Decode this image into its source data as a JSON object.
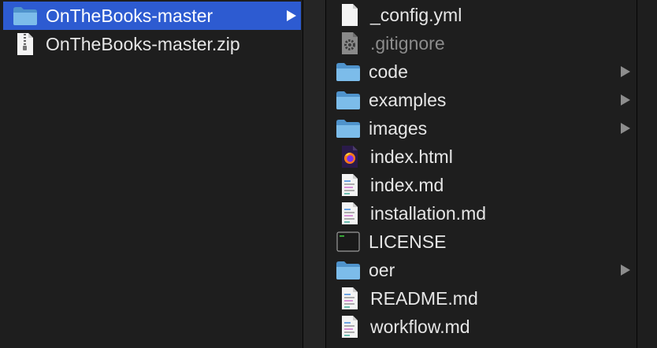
{
  "left_column": {
    "items": [
      {
        "label": "OnTheBooks-master",
        "icon": "folder-icon",
        "selected": true,
        "has_children": true
      },
      {
        "label": "OnTheBooks-master.zip",
        "icon": "zip-file-icon",
        "selected": false,
        "has_children": false
      }
    ]
  },
  "right_column": {
    "items": [
      {
        "label": "_config.yml",
        "icon": "document-icon",
        "has_children": false,
        "dim": false
      },
      {
        "label": ".gitignore",
        "icon": "gear-document-icon",
        "has_children": false,
        "dim": true
      },
      {
        "label": "code",
        "icon": "folder-icon",
        "has_children": true,
        "dim": false
      },
      {
        "label": "examples",
        "icon": "folder-icon",
        "has_children": true,
        "dim": false
      },
      {
        "label": "images",
        "icon": "folder-icon",
        "has_children": true,
        "dim": false
      },
      {
        "label": "index.html",
        "icon": "firefox-html-icon",
        "has_children": false,
        "dim": false
      },
      {
        "label": "index.md",
        "icon": "text-document-icon",
        "has_children": false,
        "dim": false
      },
      {
        "label": "installation.md",
        "icon": "text-document-icon",
        "has_children": false,
        "dim": false
      },
      {
        "label": "LICENSE",
        "icon": "terminal-executable-icon",
        "has_children": false,
        "dim": false
      },
      {
        "label": "oer",
        "icon": "folder-icon",
        "has_children": true,
        "dim": false
      },
      {
        "label": "README.md",
        "icon": "text-document-icon",
        "has_children": false,
        "dim": false
      },
      {
        "label": "workflow.md",
        "icon": "text-document-icon",
        "has_children": false,
        "dim": false
      }
    ]
  },
  "colors": {
    "background": "#1e1e1e",
    "selection": "#2d5bd1",
    "folder": "#6aaee0",
    "text": "#e6e6e6",
    "dim_text": "#8c8c8c"
  }
}
